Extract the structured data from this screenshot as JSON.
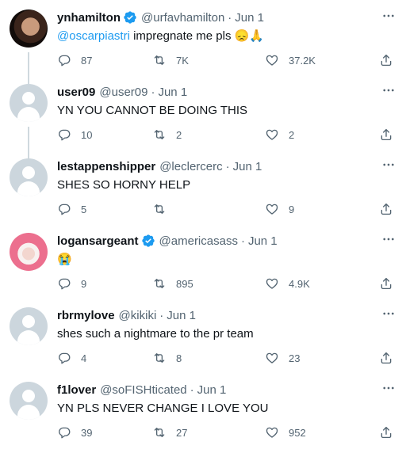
{
  "tweets": [
    {
      "name": "ynhamilton",
      "verified": true,
      "handle": "@urfavhamilton",
      "date": "Jun 1",
      "mention": "@oscarpiastri",
      "text": "impregnate me pls",
      "emoji": "😞🙏",
      "replies": "87",
      "retweets": "7K",
      "likes": "37.2K",
      "avatar": "photo-dark"
    },
    {
      "name": "user09",
      "verified": false,
      "handle": "@user09",
      "date": "Jun 1",
      "text": "YN YOU CANNOT BE DOING THIS",
      "replies": "10",
      "retweets": "2",
      "likes": "2",
      "avatar": "default"
    },
    {
      "name": "lestappenshipper",
      "verified": false,
      "handle": "@leclercerc",
      "date": "Jun 1",
      "text": "SHES SO HORNY HELP",
      "replies": "5",
      "retweets": "",
      "likes": "9",
      "avatar": "default"
    },
    {
      "name": "logansargeant",
      "verified": true,
      "handle": "@americasass",
      "date": "Jun 1",
      "emoji": "😭",
      "replies": "9",
      "retweets": "895",
      "likes": "4.9K",
      "avatar": "photo-pink"
    },
    {
      "name": "rbrmylove",
      "verified": false,
      "handle": "@kikiki",
      "date": "Jun 1",
      "text": "shes such a nightmare to the pr team",
      "replies": "4",
      "retweets": "8",
      "likes": "23",
      "avatar": "default"
    },
    {
      "name": "f1lover",
      "verified": false,
      "handle": "@soFISHticated",
      "date": "Jun 1",
      "text": "YN PLS NEVER CHANGE I LOVE YOU",
      "replies": "39",
      "retweets": "27",
      "likes": "952",
      "avatar": "default"
    }
  ],
  "colors": {
    "accent": "#1d9bf0",
    "secondary_text": "#536471",
    "thread_line": "#cfd9de",
    "verified_badge": "#1d9bf0"
  }
}
